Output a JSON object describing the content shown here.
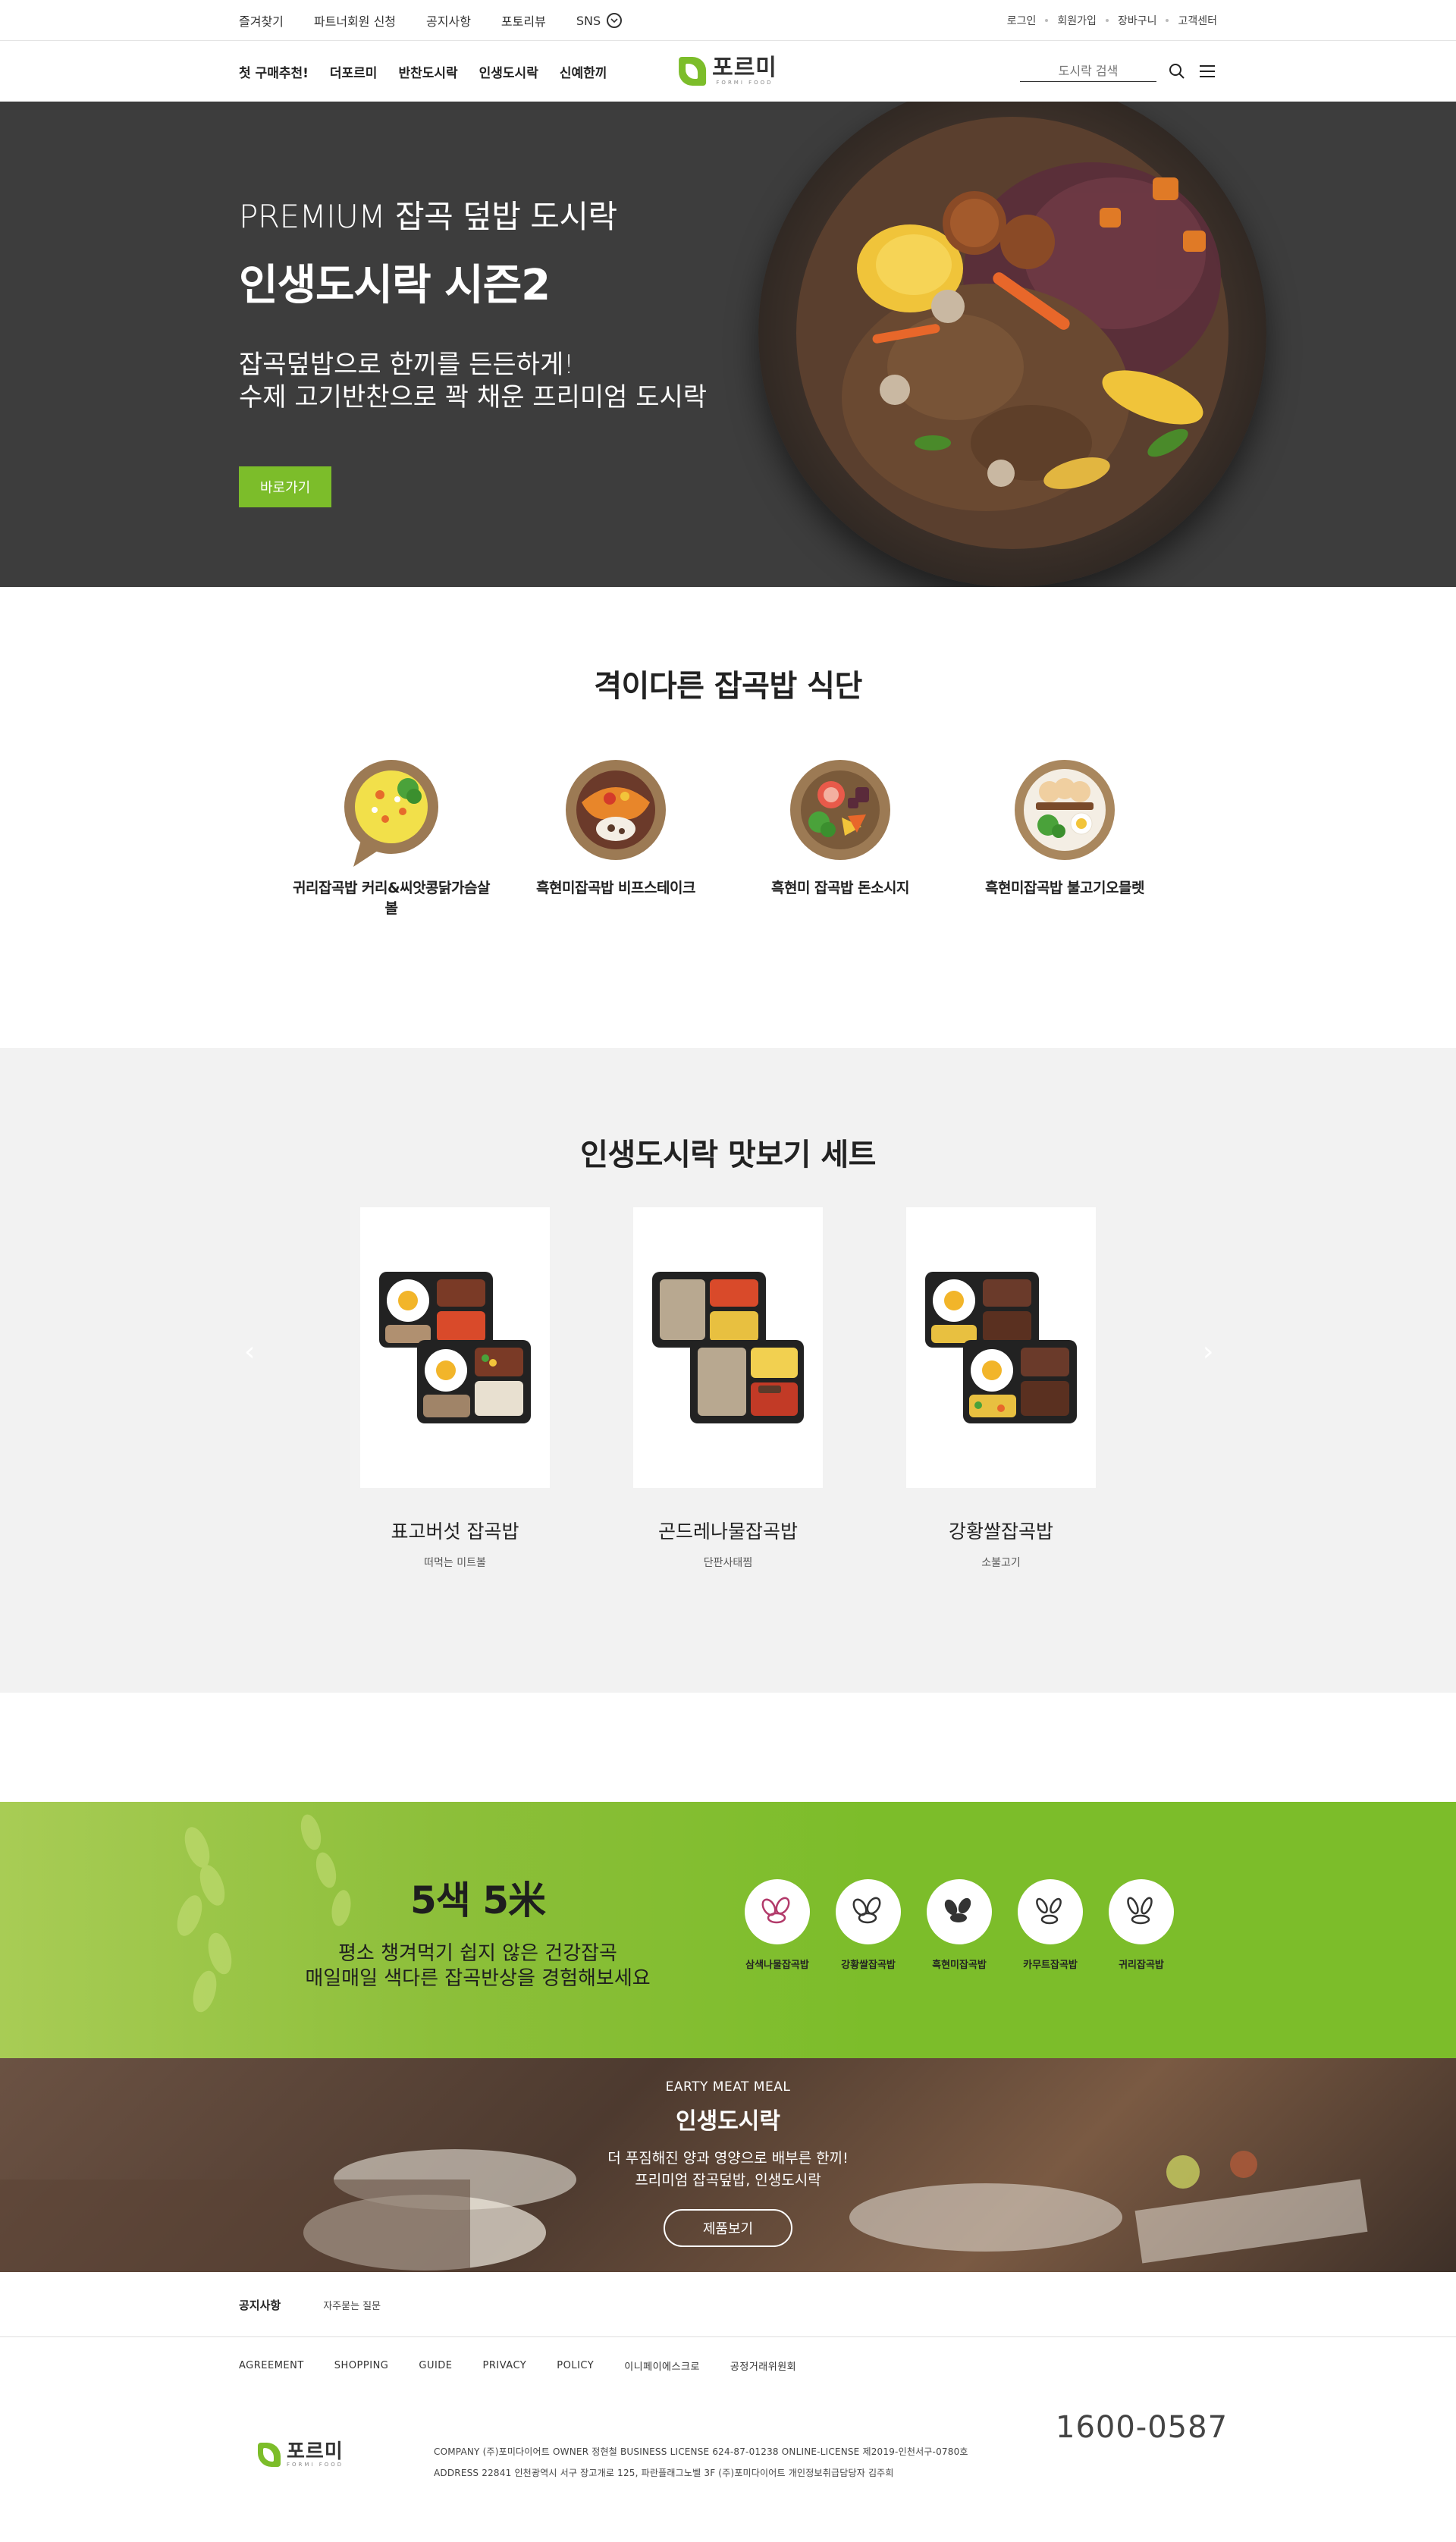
{
  "topbar": {
    "left": [
      "즐겨찾기",
      "파트너회원 신청",
      "공지사항",
      "포토리뷰",
      "SNS"
    ],
    "right": [
      "로그인",
      "회원가입",
      "장바구니",
      "고객센터"
    ]
  },
  "nav": {
    "menu": [
      "첫 구매추천!",
      "더포르미",
      "반찬도시락",
      "인생도시락",
      "신예한끼"
    ],
    "logo_text": "포르미",
    "logo_sub": "FORMI FOOD",
    "search_placeholder": "도시락 검색"
  },
  "hero": {
    "subtitle": "PREMIUM 잡곡 덮밥 도시락",
    "title": "인생도시락 시즌2",
    "desc_line1": "잡곡덮밥으로 한끼를 든든하게!",
    "desc_line2": "수제 고기반찬으로 꽉 채운 프리미엄 도시락",
    "button": "바로가기"
  },
  "meals": {
    "title": "격이다른 잡곡밥 식단",
    "items": [
      {
        "label": "귀리잡곡밥 커리&씨앗콩닭가슴살볼",
        "icon": "curry-bowl-icon"
      },
      {
        "label": "흑현미잡곡밥 비프스테이크",
        "icon": "steak-bowl-icon"
      },
      {
        "label": "흑현미 잡곡밥 돈소시지",
        "icon": "sausage-bowl-icon"
      },
      {
        "label": "흑현미잡곡밥 불고기오믈렛",
        "icon": "omelette-bowl-icon"
      }
    ]
  },
  "taste": {
    "title": "인생도시락 맛보기 세트",
    "products": [
      {
        "name": "표고버섯 잡곡밥",
        "sub": "떠먹는 미트볼"
      },
      {
        "name": "곤드레나물잡곡밥",
        "sub": "단판사태찜"
      },
      {
        "name": "강황쌀잡곡밥",
        "sub": "소불고기"
      }
    ],
    "prev": "‹",
    "next": "›"
  },
  "grain_band": {
    "title": "5색 5米",
    "desc_line1": "평소 챙겨먹기 쉽지 않은 건강잡곡",
    "desc_line2": "매일매일 색다른 잡곡반상을 경험해보세요",
    "grains": [
      {
        "label": "삼색나물잡곡밥",
        "color": "#b23a6a"
      },
      {
        "label": "강황쌀잡곡밥",
        "color": "#333333"
      },
      {
        "label": "흑현미잡곡밥",
        "color": "#333333"
      },
      {
        "label": "카무트잡곡밥",
        "color": "#333333"
      },
      {
        "label": "귀리잡곡밥",
        "color": "#333333"
      }
    ]
  },
  "meal_banner": {
    "small": "EARTY MEAT MEAL",
    "title": "인생도시락",
    "desc_line1": "더 푸짐해진 양과 영양으로 배부른 한끼!",
    "desc_line2": "프리미엄 잡곡덮밥, 인생도시락",
    "button": "제품보기"
  },
  "footer": {
    "notice_title": "공지사항",
    "notice_link": "자주묻는 질문",
    "links": [
      "AGREEMENT",
      "SHOPPING",
      "GUIDE",
      "PRIVACY",
      "POLICY",
      "이니페이에스크로",
      "공정거래위원회"
    ],
    "info_line1": "COMPANY (주)포미다이어트 OWNER 정현철 BUSINESS LICENSE 624-87-01238 ONLINE-LICENSE 제2019-인천서구-0780호",
    "info_line2": "ADDRESS 22841 인천광역시 서구 장고개로 125, 파란플래그노벨 3F (주)포미다이어트 개인정보취급담당자 김주희",
    "phone": "1600-0587"
  },
  "colors": {
    "accent": "#7cbd2a",
    "hero_bg": "#3d3d3d",
    "section_gray": "#f2f2f2"
  }
}
